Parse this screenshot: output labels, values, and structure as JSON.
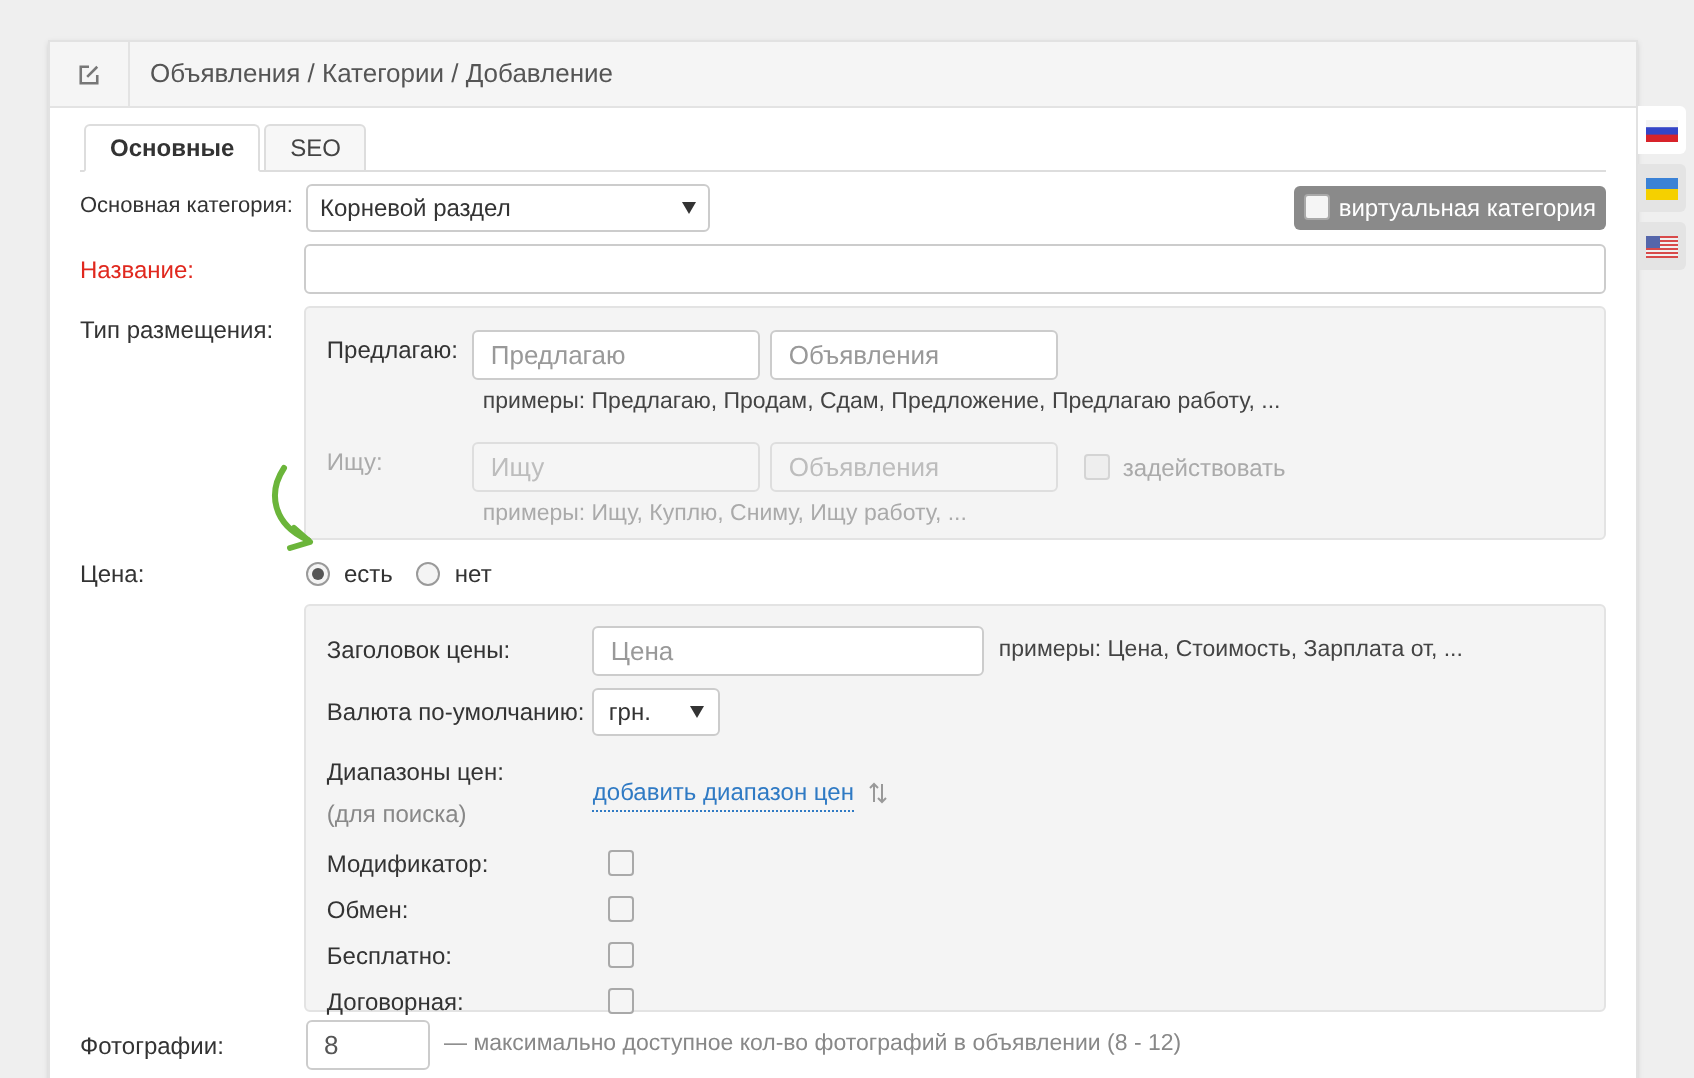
{
  "breadcrumb": "Объявления / Категории / Добавление",
  "tabs": [
    {
      "label": "Основные",
      "selected": true
    },
    {
      "label": "SEO",
      "selected": false
    }
  ],
  "languages": [
    {
      "kind": "ru",
      "selected": true
    },
    {
      "kind": "ua",
      "selected": false
    },
    {
      "kind": "us",
      "selected": false
    }
  ],
  "main_category": {
    "label": "Основная категория:",
    "value": "Корневой раздел"
  },
  "virtual_category": {
    "label": "виртуальная категория",
    "checked": false
  },
  "name": {
    "label": "Название:",
    "required": true
  },
  "placement": {
    "label": "Тип размещения:",
    "rows": [
      {
        "label": "Предлагаю:",
        "placeholder_1": "Предлагаю",
        "placeholder_2": "Объявления",
        "examples": "примеры: Предлагаю, Продам, Сдам, Предложение, Предлагаю работу, ...",
        "disabled": false
      },
      {
        "label": "Ищу:",
        "placeholder_1": "Ищу",
        "placeholder_2": "Объявления",
        "examples": "примеры: Ищу, Куплю, Сниму, Ищу работу, ...",
        "disabled": true,
        "toggle": {
          "label": "задействовать",
          "checked": false
        }
      }
    ]
  },
  "price": {
    "label": "Цена:",
    "options": [
      {
        "label": "есть",
        "selected": true
      },
      {
        "label": "нет",
        "selected": false
      }
    ],
    "title": {
      "label": "Заголовок цены:",
      "placeholder": "Цена",
      "examples": "примеры: Цена, Стоимость, Зарплата от, ..."
    },
    "currency": {
      "label": "Валюта по-умолчанию:",
      "value": "грн."
    },
    "ranges": {
      "label": "Диапазоны цен:",
      "note": "(для поиска)",
      "link": "добавить диапазон цен"
    },
    "flags": [
      {
        "label": "Модификатор:",
        "checked": false
      },
      {
        "label": "Обмен:",
        "checked": false
      },
      {
        "label": "Бесплатно:",
        "checked": false
      },
      {
        "label": "Договорная:",
        "checked": false
      }
    ]
  },
  "photos": {
    "label": "Фотографии:",
    "value": "8",
    "hint": "— максимально доступное кол-во фотографий в объявлении (8 - 12)"
  }
}
